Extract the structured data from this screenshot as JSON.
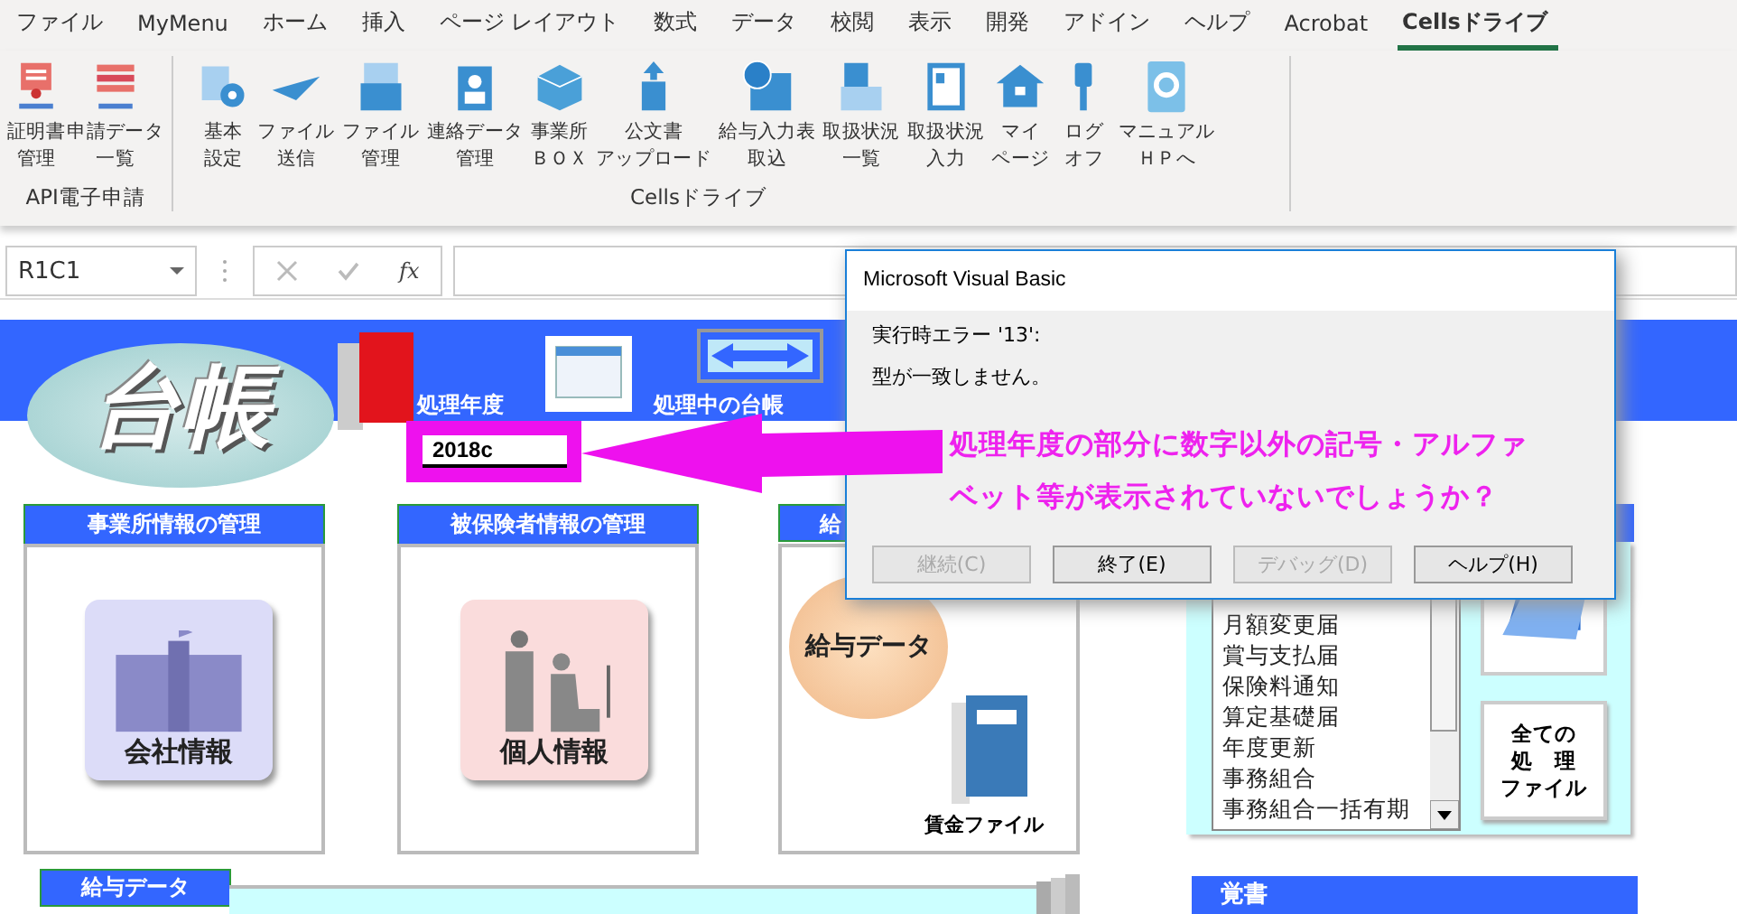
{
  "menu_tabs": [
    {
      "label": "ファイル",
      "selected": false
    },
    {
      "label": "MyMenu",
      "selected": false
    },
    {
      "label": "ホーム",
      "selected": false
    },
    {
      "label": "挿入",
      "selected": false
    },
    {
      "label": "ページ レイアウト",
      "selected": false
    },
    {
      "label": "数式",
      "selected": false
    },
    {
      "label": "データ",
      "selected": false
    },
    {
      "label": "校閲",
      "selected": false
    },
    {
      "label": "表示",
      "selected": false
    },
    {
      "label": "開発",
      "selected": false
    },
    {
      "label": "アドイン",
      "selected": false
    },
    {
      "label": "ヘルプ",
      "selected": false
    },
    {
      "label": "Acrobat",
      "selected": false
    },
    {
      "label": "Cellsドライブ",
      "selected": true
    }
  ],
  "ribbon": {
    "groups": [
      {
        "label": "API電子申請",
        "buttons": [
          {
            "kind": "certificate",
            "lines": [
              "証明書",
              "管理"
            ]
          },
          {
            "kind": "list",
            "lines": [
              "申請データ",
              "一覧"
            ]
          }
        ]
      },
      {
        "label": "Cellsドライブ",
        "buttons": [
          {
            "kind": "settings",
            "lines": [
              "基本",
              "設定"
            ]
          },
          {
            "kind": "plane",
            "lines": [
              "ファイル",
              "送信"
            ]
          },
          {
            "kind": "files",
            "lines": [
              "ファイル",
              "管理"
            ]
          },
          {
            "kind": "contact",
            "lines": [
              "連絡データ",
              "管理"
            ]
          },
          {
            "kind": "cube",
            "lines": [
              "事業所",
              "ＢＯＸ"
            ]
          },
          {
            "kind": "upload",
            "lines": [
              "公文書",
              "アップロード"
            ]
          },
          {
            "kind": "yen",
            "lines": [
              "給与入力表",
              "取込"
            ]
          },
          {
            "kind": "status",
            "lines": [
              "取扱状況",
              "一覧"
            ]
          },
          {
            "kind": "card",
            "lines": [
              "取扱状況",
              "入力"
            ]
          },
          {
            "kind": "home",
            "lines": [
              "マイ",
              "ページ"
            ]
          },
          {
            "kind": "key",
            "lines": [
              "ログ",
              "オフ"
            ]
          },
          {
            "kind": "help",
            "lines": [
              "マニュアル",
              "ＨＰへ"
            ]
          }
        ]
      }
    ]
  },
  "formula_bar": {
    "name_box": "R1C1",
    "function_label": "fx"
  },
  "sheet": {
    "logo": "台帳",
    "year_label": "処理年度",
    "year_value": "2018c",
    "current_ledger_label": "処理中の台帳",
    "cards": [
      {
        "kind": "company",
        "header": "事業所情報の管理",
        "tile": "会社情報"
      },
      {
        "kind": "person",
        "header": "被保険者情報の管理",
        "tile": "個人情報"
      },
      {
        "kind": "payroll",
        "header": "給",
        "tile": "給与データ",
        "file_label": "賃金ファイル"
      }
    ],
    "procedures": {
      "items": [
        "月額変更届",
        "賞与支払届",
        "保険料通知",
        "算定基礎届",
        "年度更新",
        "事務組合",
        "事務組合一括有期"
      ],
      "all_files_button": [
        "全ての",
        "処　理",
        "ファイル"
      ]
    },
    "payroll_header": "給与データ",
    "memo_header": "覚書"
  },
  "annotation": {
    "lines": [
      "処理年度の部分に数字以外の記号・アルファ",
      "ベット等が表示されていないでしょうか？"
    ]
  },
  "dialog": {
    "title": "Microsoft Visual Basic",
    "messages": [
      "実行時エラー '13':",
      "型が一致しません。"
    ],
    "buttons": [
      {
        "label": "継続(C)",
        "disabled": true
      },
      {
        "label": "終了(E)",
        "disabled": false
      },
      {
        "label": "デバッグ(D)",
        "disabled": true
      },
      {
        "label": "ヘルプ(H)",
        "disabled": false
      }
    ]
  }
}
